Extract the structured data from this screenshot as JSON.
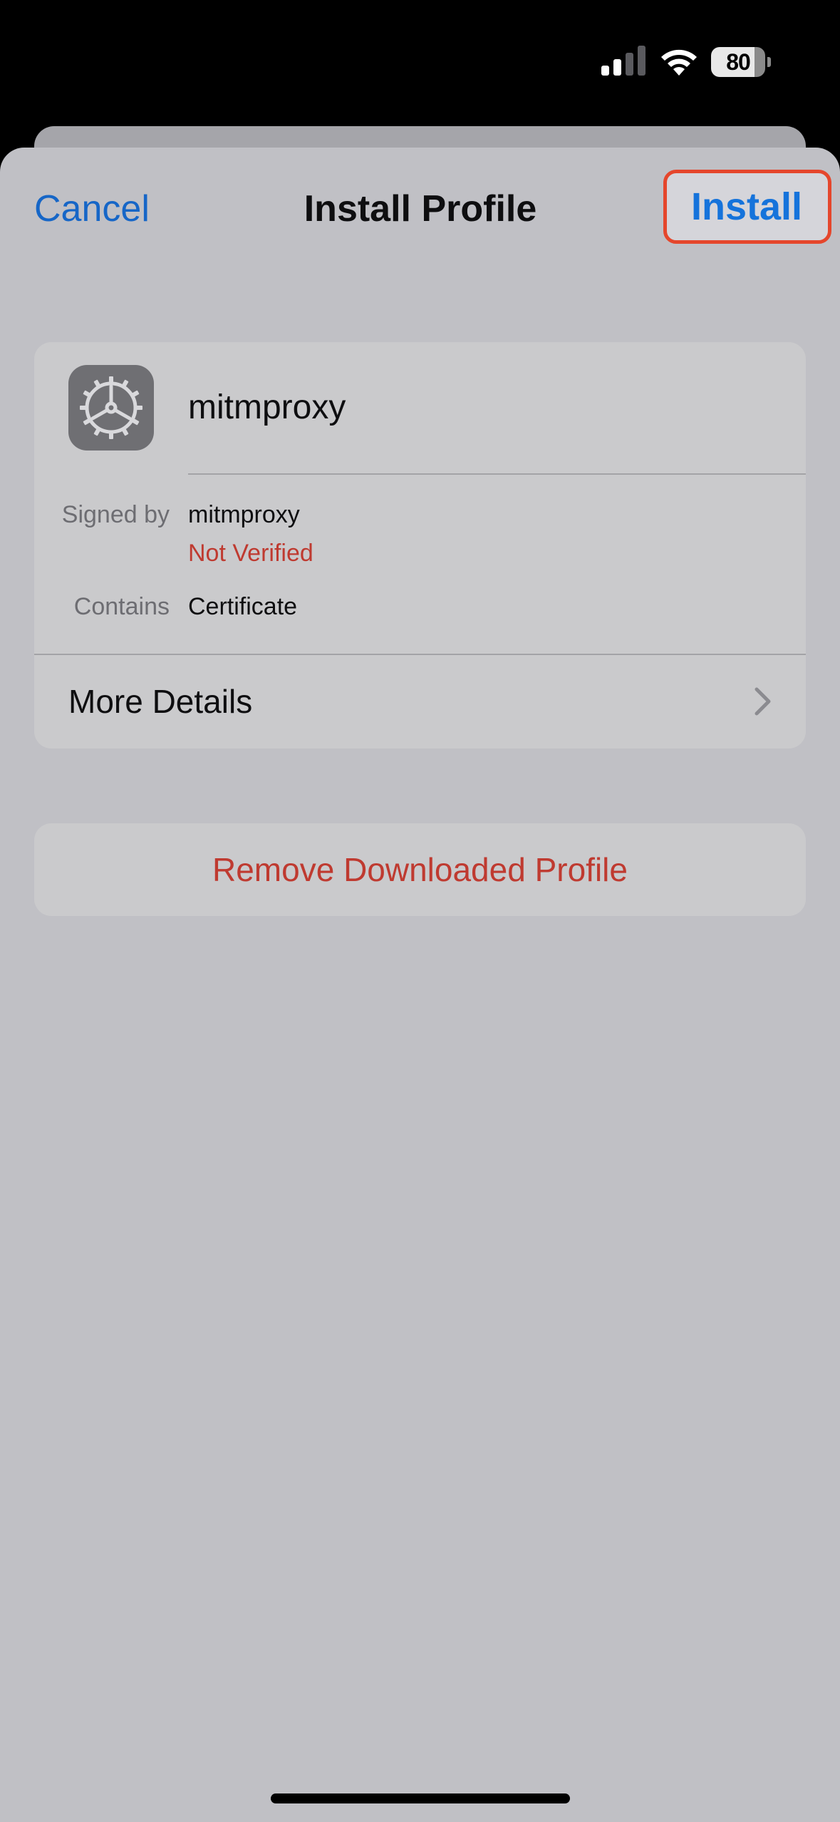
{
  "status_bar": {
    "battery_level": "80",
    "signal_icon": "cellular-signal-icon",
    "wifi_icon": "wifi-icon",
    "battery_icon": "battery-icon"
  },
  "nav": {
    "cancel_label": "Cancel",
    "title": "Install Profile",
    "install_label": "Install",
    "highlight_color": "#e5462c"
  },
  "profile": {
    "icon": "settings-gear-icon",
    "name": "mitmproxy",
    "signed_by_label": "Signed by",
    "signed_by_value": "mitmproxy",
    "verification_status": "Not Verified",
    "contains_label": "Contains",
    "contains_value": "Certificate",
    "more_details_label": "More Details",
    "more_details_icon": "chevron-right-icon"
  },
  "actions": {
    "remove_label": "Remove Downloaded Profile"
  },
  "colors": {
    "accent": "#1666c7",
    "destructive": "#bf3a30",
    "sheet_background": "#c0c0c5",
    "card_background": "#cacacc"
  }
}
